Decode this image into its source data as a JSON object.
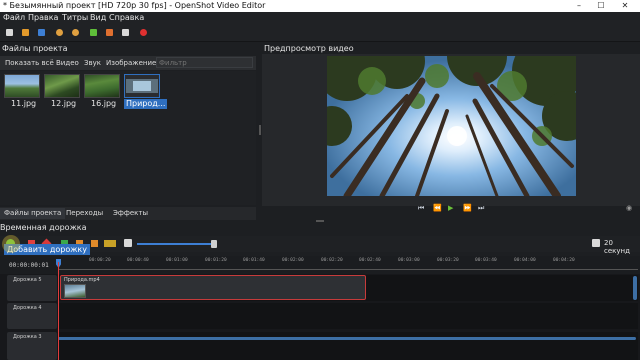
{
  "window": {
    "title": "* Безымянный проект [HD 720p 30 fps] - OpenShot Video Editor",
    "minimize": "–",
    "maximize": "☐",
    "close": "✕"
  },
  "menu": [
    "Файл",
    "Правка",
    "Титры",
    "Вид",
    "Справка"
  ],
  "project_files": {
    "title": "Файлы проекта",
    "filters": [
      "Показать всё",
      "Видео",
      "Звук",
      "Изображение"
    ],
    "filter_placeholder": "Фильтр",
    "files": [
      {
        "label": "11.jpg"
      },
      {
        "label": "12.jpg"
      },
      {
        "label": "16.jpg"
      },
      {
        "label": "Природ...",
        "selected": true
      }
    ]
  },
  "preview": {
    "title": "Предпросмотр видео"
  },
  "bottom_tabs": [
    "Файлы проекта",
    "Переходы",
    "Эффекты"
  ],
  "timeline": {
    "title": "Временная дорожка",
    "add_track_tooltip": "Добавить дорожку",
    "zoom_label": "20 секунд",
    "current_time": "00:00:00:01",
    "ruler_ticks": [
      "00:00:20",
      "00:00:40",
      "00:01:00",
      "00:01:20",
      "00:01:40",
      "00:02:00",
      "00:02:20",
      "00:02:40",
      "00:03:00",
      "00:03:20",
      "00:03:40",
      "00:04:00",
      "00:04:20"
    ],
    "tracks": [
      {
        "name": "Дорожка 5",
        "clip": "Природа.mp4"
      },
      {
        "name": "Дорожка 4"
      },
      {
        "name": "Дорожка 3"
      }
    ]
  },
  "colors": {
    "accent": "#2f6fbf",
    "clip_border": "#c73b3b",
    "playhead": "#e03c3c",
    "play_green": "#6bbf3a"
  }
}
